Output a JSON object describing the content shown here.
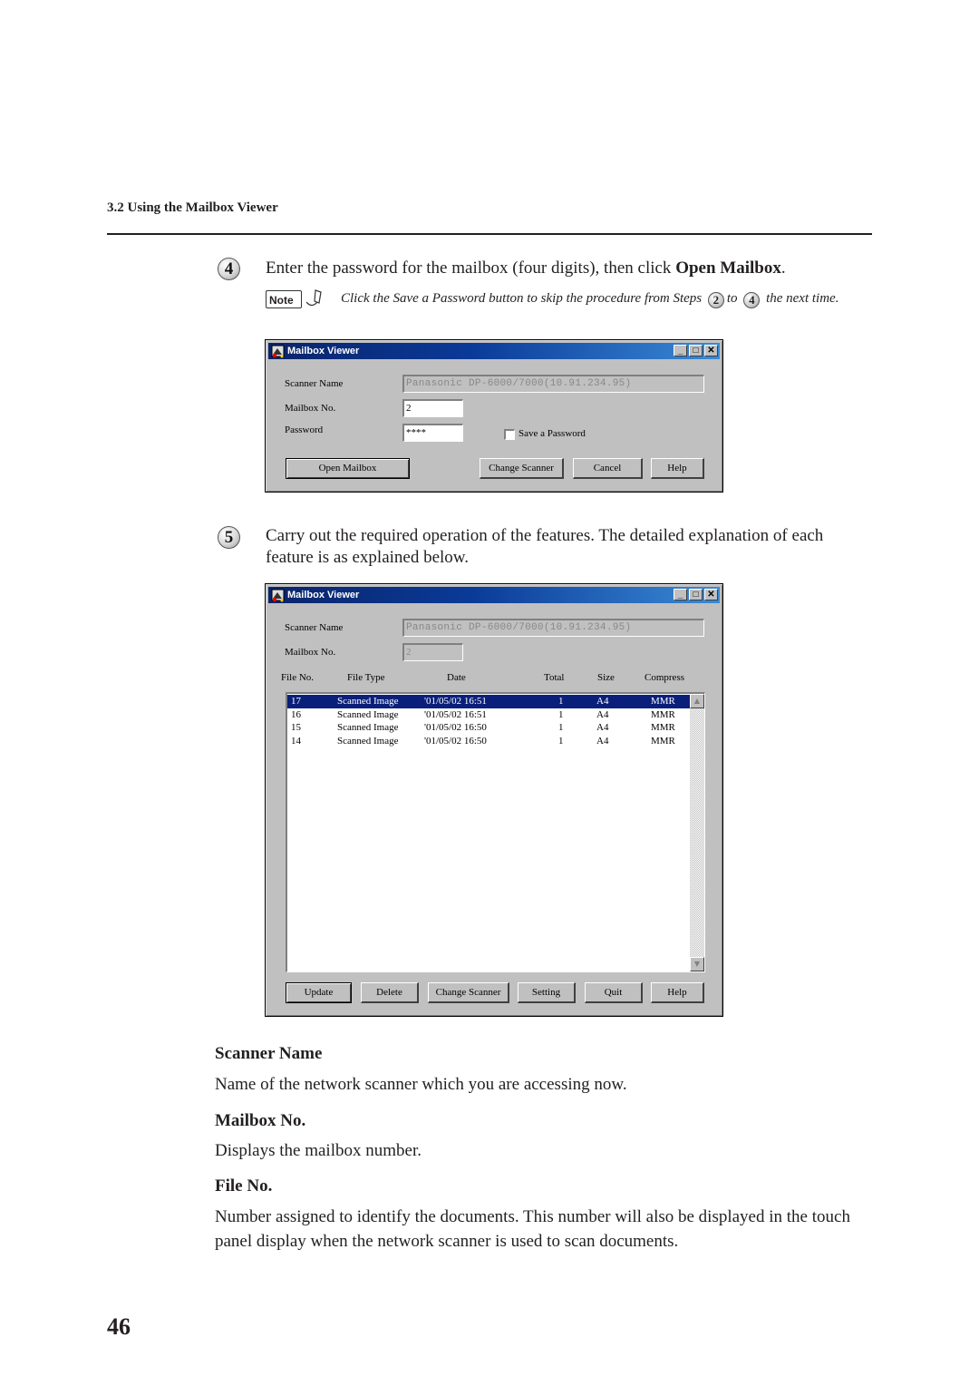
{
  "page": {
    "section_header": "3.2  Using the Mailbox Viewer",
    "page_number": "46"
  },
  "step4": {
    "number": "4",
    "text_before": "Enter the password for the mailbox (four digits), then click ",
    "text_bold": "Open Mailbox",
    "text_after": ".",
    "note": {
      "badge": "Note",
      "text_1": "Click the Save a Password button to skip the procedure from Steps",
      "step_a": "2",
      "text_2": "to",
      "step_b": "4",
      "text_3": "the next time."
    }
  },
  "dialog1": {
    "title": "Mailbox Viewer",
    "title_buttons": {
      "minimize": "_",
      "maximize": "□",
      "close": "✕"
    },
    "scanner_name_label": "Scanner Name",
    "scanner_name_value": "Panasonic DP-6000/7000(10.91.234.95)",
    "mailbox_no_label": "Mailbox No.",
    "mailbox_no_value": "2",
    "password_label": "Password",
    "password_value": "****",
    "save_password_label": "Save a Password",
    "save_password_checked": false,
    "buttons": {
      "open_mailbox": "Open Mailbox",
      "change_scanner": "Change Scanner",
      "cancel": "Cancel",
      "help": "Help"
    }
  },
  "step5": {
    "number": "5",
    "text": "Carry out the required operation of the features. The detailed explanation of each feature is as explained below."
  },
  "dialog2": {
    "title": "Mailbox Viewer",
    "title_buttons": {
      "minimize": "_",
      "maximize": "□",
      "close": "✕"
    },
    "scanner_name_label": "Scanner Name",
    "scanner_name_value": "Panasonic DP-6000/7000(10.91.234.95)",
    "mailbox_no_label": "Mailbox No.",
    "mailbox_no_value": "2",
    "columns": [
      "File No.",
      "File Type",
      "Date",
      "Total",
      "Size",
      "Compress"
    ],
    "rows": [
      {
        "file_no": "17",
        "file_type": "Scanned Image",
        "date": "'01/05/02 16:51",
        "total": "1",
        "size": "A4",
        "compress": "MMR",
        "selected": true
      },
      {
        "file_no": "16",
        "file_type": "Scanned Image",
        "date": "'01/05/02 16:51",
        "total": "1",
        "size": "A4",
        "compress": "MMR",
        "selected": false
      },
      {
        "file_no": "15",
        "file_type": "Scanned Image",
        "date": "'01/05/02 16:50",
        "total": "1",
        "size": "A4",
        "compress": "MMR",
        "selected": false
      },
      {
        "file_no": "14",
        "file_type": "Scanned Image",
        "date": "'01/05/02 16:50",
        "total": "1",
        "size": "A4",
        "compress": "MMR",
        "selected": false
      }
    ],
    "scroll_up": "▲",
    "scroll_down": "▼",
    "buttons": {
      "update": "Update",
      "delete": "Delete",
      "change_scanner": "Change Scanner",
      "setting": "Setting",
      "quit": "Quit",
      "help": "Help"
    }
  },
  "definitions": [
    {
      "title": "Scanner Name",
      "body": "Name of the network scanner which you are accessing now."
    },
    {
      "title": "Mailbox No.",
      "body": "Displays the mailbox number."
    },
    {
      "title": "File No.",
      "body": "Number assigned to identify the documents. This number will also be displayed in the touch panel display when the network scanner is used to scan documents."
    }
  ]
}
